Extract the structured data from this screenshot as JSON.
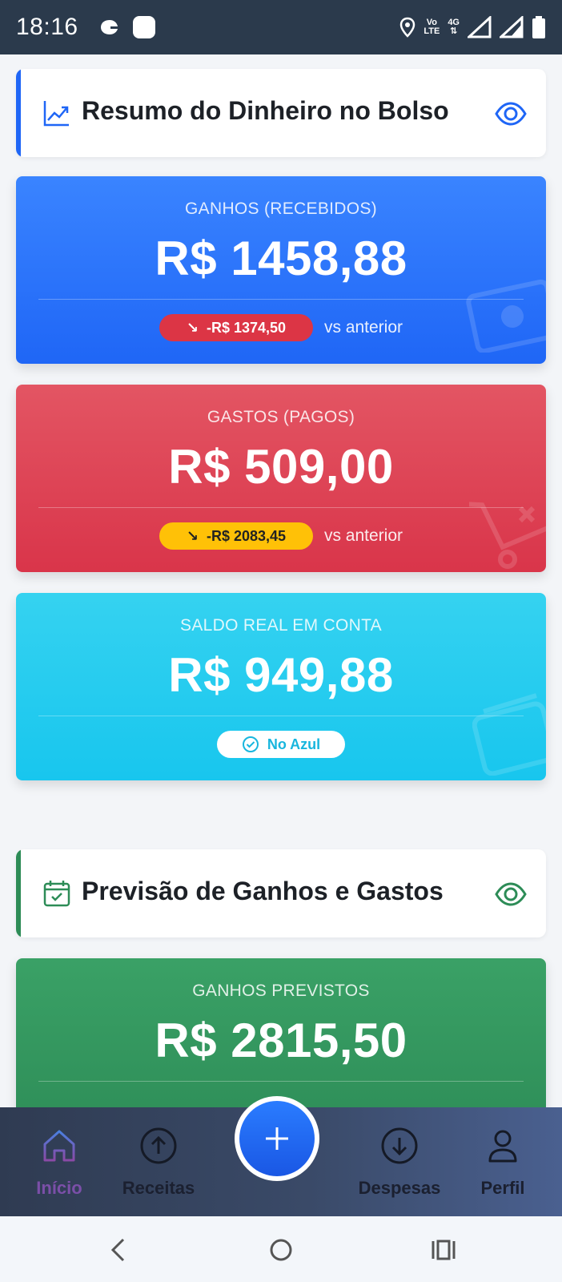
{
  "status_bar": {
    "time": "18:16",
    "volte_top": "Vo",
    "volte_bottom": "LTE",
    "network": "4G"
  },
  "summary": {
    "title": "Resumo do Dinheiro no Bolso",
    "accent": "#1f66f6",
    "cards": [
      {
        "label": "GANHOS (RECEBIDOS)",
        "value": "R$ 1458,88",
        "change": "-R$ 1374,50",
        "change_color": "#dc3545",
        "compare_text": "vs anterior"
      },
      {
        "label": "GASTOS (PAGOS)",
        "value": "R$ 509,00",
        "change": "-R$ 2083,45",
        "change_color": "#ffc107",
        "compare_text": "vs anterior"
      },
      {
        "label": "SALDO REAL EM CONTA",
        "value": "R$ 949,88",
        "status": "No Azul"
      }
    ]
  },
  "forecast": {
    "title": "Previsão de Ganhos e Gastos",
    "accent": "#2d8c57",
    "cards": [
      {
        "label": "GANHOS PREVISTOS",
        "value": "R$ 2815,50"
      }
    ]
  },
  "bottom_nav": {
    "items": [
      {
        "label": "Início",
        "icon": "home-icon",
        "active": true,
        "color": "#7b4fa8"
      },
      {
        "label": "Receitas",
        "icon": "arrow-up-circle-icon"
      },
      {
        "label": "Despesas",
        "icon": "arrow-down-circle-icon"
      },
      {
        "label": "Perfil",
        "icon": "user-icon"
      }
    ],
    "fab_icon": "plus-icon"
  },
  "system_nav": [
    "back-icon",
    "home-circle-icon",
    "recents-icon"
  ]
}
